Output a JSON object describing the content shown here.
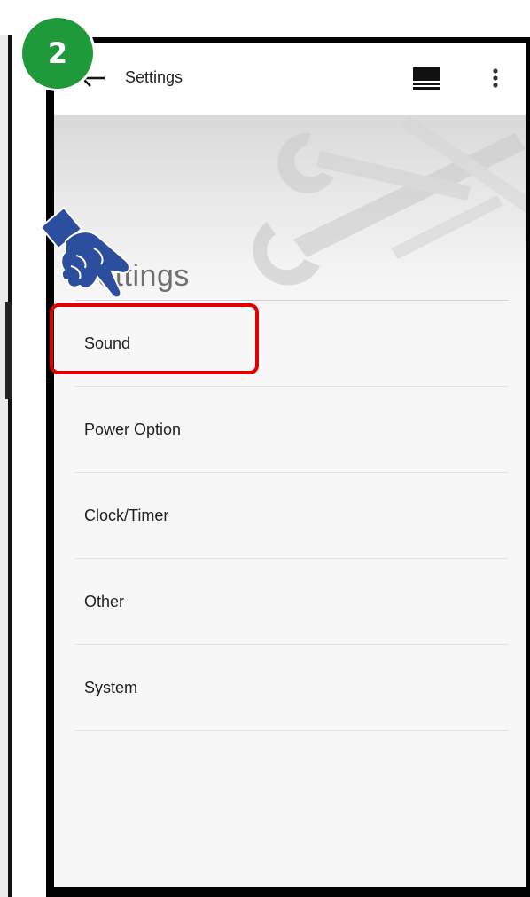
{
  "step": {
    "number": "2"
  },
  "appbar": {
    "title": "Settings",
    "back_icon": "arrow-back-icon",
    "display_icon": "display-mode-icon",
    "more_icon": "more-vert-icon"
  },
  "header": {
    "section_title": "Settings"
  },
  "menu": {
    "items": [
      {
        "label": "Sound"
      },
      {
        "label": "Power Option"
      },
      {
        "label": "Clock/Timer"
      },
      {
        "label": "Other"
      },
      {
        "label": "System"
      }
    ]
  },
  "colors": {
    "badge": "#1e9a3a",
    "highlight": "#e00000",
    "hand": "#2b4f9e"
  }
}
